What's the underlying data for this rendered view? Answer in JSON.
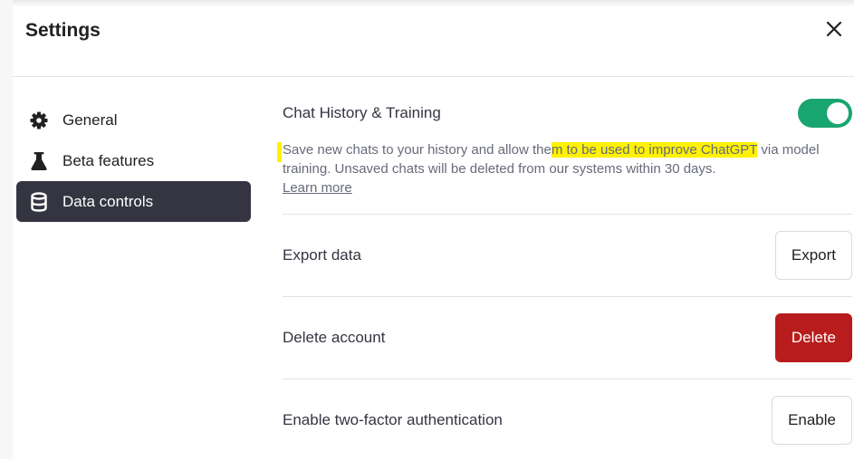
{
  "dialog": {
    "title": "Settings"
  },
  "sidebar": {
    "items": [
      {
        "label": "General",
        "icon": "gear-icon",
        "active": false
      },
      {
        "label": "Beta features",
        "icon": "flask-icon",
        "active": false
      },
      {
        "label": "Data controls",
        "icon": "database-icon",
        "active": true
      }
    ]
  },
  "chat_history": {
    "title": "Chat History & Training",
    "toggle_on": true,
    "desc_part1": "Save new chats to your history and allow the",
    "desc_highlight": "m to be used to improve ChatGPT",
    "desc_part2": " via model training. Unsaved chats will be deleted from our systems within 30 days.",
    "learn_more": "Learn more"
  },
  "rows": {
    "export": {
      "label": "Export data",
      "button": "Export"
    },
    "delete": {
      "label": "Delete account",
      "button": "Delete"
    },
    "twofa": {
      "label": "Enable two-factor authentication",
      "button": "Enable"
    }
  },
  "colors": {
    "active_nav": "#343541",
    "toggle_on": "#19a56f",
    "danger": "#b91c1c",
    "highlight": "#fff200"
  }
}
